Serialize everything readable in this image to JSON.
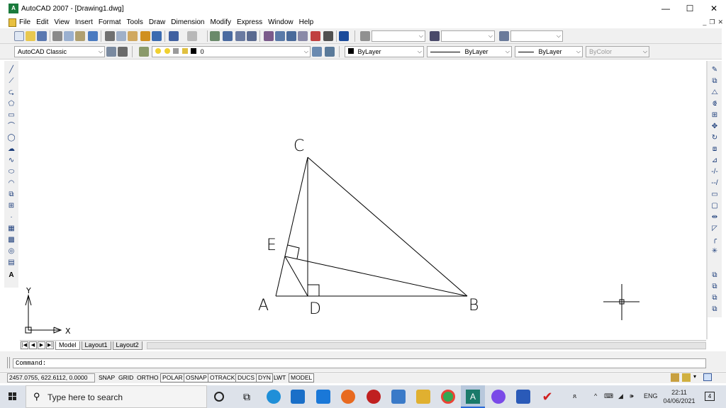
{
  "window": {
    "title": "AutoCAD 2007 - [Drawing1.dwg]",
    "minimize": "—",
    "maximize": "☐",
    "close": "✕"
  },
  "menu": [
    "File",
    "Edit",
    "View",
    "Insert",
    "Format",
    "Tools",
    "Draw",
    "Dimension",
    "Modify",
    "Express",
    "Window",
    "Help"
  ],
  "toolbar2": {
    "workspace": "AutoCAD Classic",
    "layer": "0",
    "color": "ByLayer",
    "linetype": "ByLayer",
    "lineweight": "ByLayer",
    "plotstyle": "ByColor"
  },
  "drawing": {
    "points": {
      "A": "A",
      "B": "B",
      "C": "C",
      "D": "D",
      "E": "E"
    },
    "ucs": {
      "x": "X",
      "y": "Y"
    }
  },
  "tabs": [
    "Model",
    "Layout1",
    "Layout2"
  ],
  "command": {
    "prompt": "Command:"
  },
  "status": {
    "coordinates": "2457.0755, 622.6112, 0.0000",
    "buttons": [
      {
        "label": "SNAP",
        "pressed": false
      },
      {
        "label": "GRID",
        "pressed": false
      },
      {
        "label": "ORTHO",
        "pressed": false
      },
      {
        "label": "POLAR",
        "pressed": true
      },
      {
        "label": "OSNAP",
        "pressed": true
      },
      {
        "label": "OTRACK",
        "pressed": true
      },
      {
        "label": "DUCS",
        "pressed": true
      },
      {
        "label": "DYN",
        "pressed": true
      },
      {
        "label": "LWT",
        "pressed": false
      },
      {
        "label": "MODEL",
        "pressed": true
      }
    ]
  },
  "taskbar": {
    "search_placeholder": "Type here to search",
    "language": "ENG",
    "time": "22:11",
    "date": "04/06/2021",
    "notifications": "4"
  }
}
